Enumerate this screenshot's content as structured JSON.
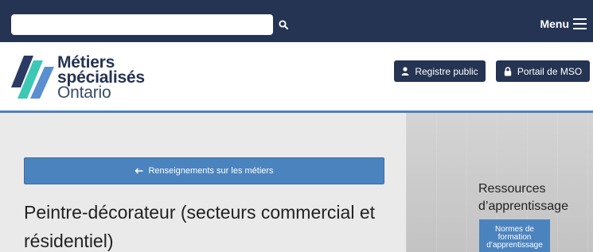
{
  "search": {
    "value": "",
    "placeholder": ""
  },
  "nav": {
    "menu_label": "Menu"
  },
  "logo": {
    "line1": "Métiers",
    "line2": "spécialisés",
    "line3": "Ontario"
  },
  "header_buttons": {
    "registre": "Registre public",
    "portail": "Portail de MSO"
  },
  "back_link": {
    "label": "Renseignements sur les métiers"
  },
  "page": {
    "title": "Peintre-décorateur (secteurs commercial et résidentiel)"
  },
  "sidebar": {
    "title_line1": "Ressources",
    "title_line2": "d’apprentissage",
    "button_lines": [
      "Normes de",
      "formation",
      "d’apprentissage"
    ]
  },
  "colors": {
    "navy": "#253453",
    "accent_blue": "#4b83be",
    "logo_teal": "#3cc8b4",
    "logo_navy": "#2b3a63",
    "logo_blue": "#5a8fd0"
  },
  "icons": {
    "search": "search-icon",
    "menu": "hamburger-icon",
    "user": "user-icon",
    "lock": "lock-icon",
    "back": "arrow-left-icon"
  }
}
